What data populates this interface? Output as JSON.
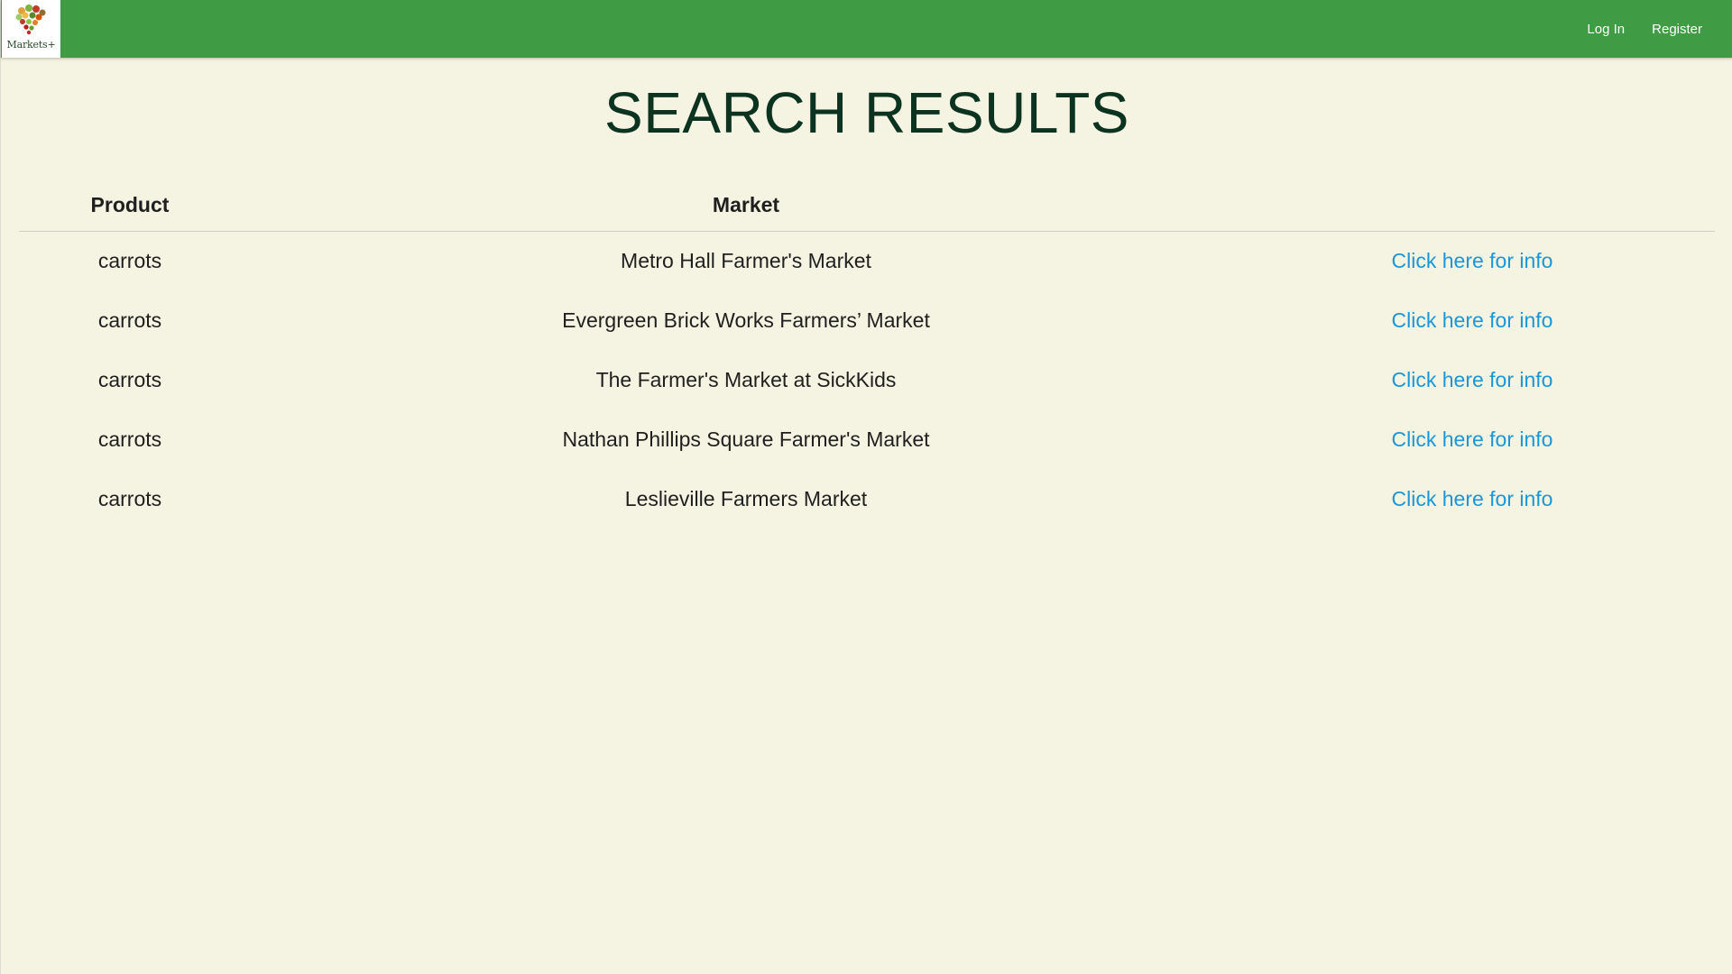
{
  "navbar": {
    "logo_text": "Markets+",
    "login_label": "Log In",
    "register_label": "Register",
    "background_color": "#409c44"
  },
  "page": {
    "title": "SEARCH RESULTS",
    "background_color": "#f5f3e1"
  },
  "table": {
    "headers": {
      "product": "Product",
      "market": "Market",
      "link": ""
    },
    "rows": [
      {
        "product": "carrots",
        "market": "Metro Hall Farmer's Market",
        "link": "Click here for info"
      },
      {
        "product": "carrots",
        "market": "Evergreen Brick Works Farmers’ Market",
        "link": "Click here for info"
      },
      {
        "product": "carrots",
        "market": "The Farmer's Market at SickKids",
        "link": "Click here for info"
      },
      {
        "product": "carrots",
        "market": "Nathan Phillips Square Farmer's Market",
        "link": "Click here for info"
      },
      {
        "product": "carrots",
        "market": "Leslieville Farmers Market",
        "link": "Click here for info"
      }
    ],
    "link_color": "#1a97d9"
  }
}
